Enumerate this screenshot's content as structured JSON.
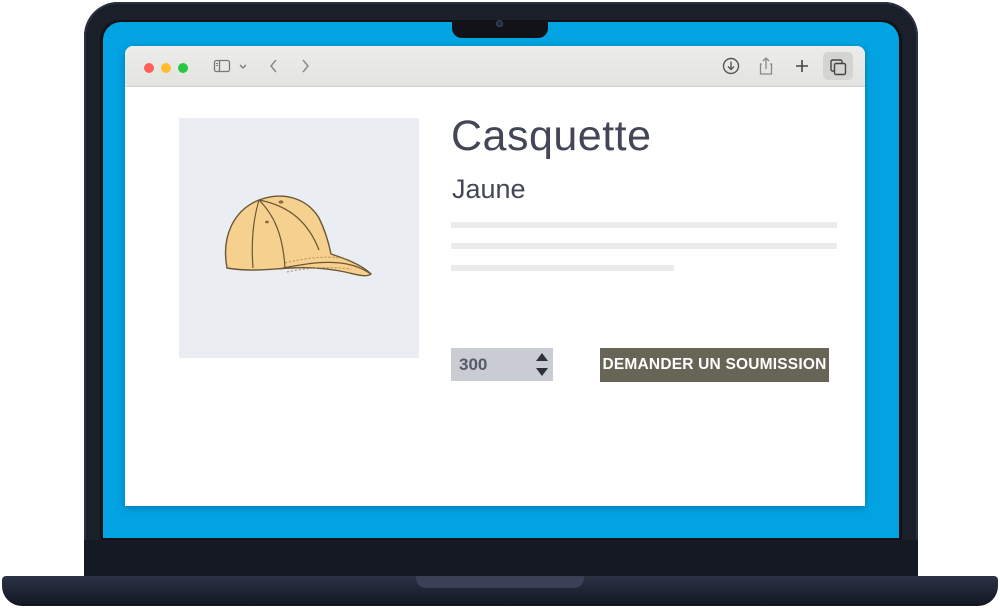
{
  "product": {
    "title": "Casquette",
    "color_name": "Jaune",
    "image_icon": "baseball-cap-illustration",
    "image_fill": "#f6d08f"
  },
  "quantity": {
    "value": "300"
  },
  "actions": {
    "request_quote_label": "DEMANDER UN SOUMISSION"
  },
  "browser": {
    "traffic_lights": {
      "close": "#fe5f57",
      "minimize": "#febc2e",
      "zoom": "#28c840"
    },
    "toolbar_icons": [
      "sidebar-icon",
      "chevron-down-icon",
      "back-icon",
      "forward-icon",
      "download-icon",
      "share-icon",
      "plus-icon",
      "tabs-overview-icon"
    ]
  },
  "theme": {
    "screen_background": "#02a3e3",
    "button_background": "#676555",
    "title_color": "#434656"
  }
}
